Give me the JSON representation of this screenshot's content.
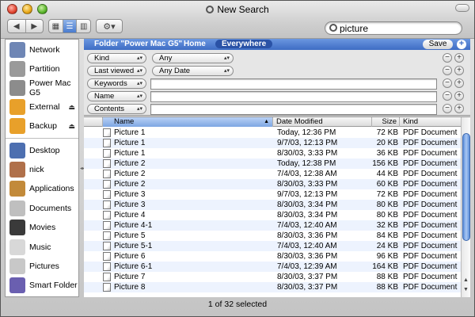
{
  "window": {
    "title": "New Search"
  },
  "toolbar": {
    "back_label": "◀",
    "forward_label": "▶",
    "view_icons": [
      "icon-view-icon",
      "list-view-icon",
      "column-view-icon"
    ],
    "action_label": "⚙▾",
    "search_value": "picture"
  },
  "sidebar": {
    "items": [
      {
        "label": "Network",
        "icon": "network-globe-icon",
        "color": "#6f86b5"
      },
      {
        "label": "Partition",
        "icon": "hard-disk-icon",
        "color": "#9a9a9a"
      },
      {
        "label": "Power Mac G5",
        "icon": "hard-disk-icon",
        "color": "#8c8c8c"
      },
      {
        "label": "External",
        "icon": "firewire-disk-icon",
        "color": "#e8a02a",
        "eject": "⏏"
      },
      {
        "label": "Backup",
        "icon": "firewire-disk-icon",
        "color": "#e8a02a",
        "eject": "⏏"
      },
      {
        "label": "Desktop",
        "icon": "desktop-icon",
        "color": "#4d6fb0"
      },
      {
        "label": "nick",
        "icon": "home-icon",
        "color": "#b0704a"
      },
      {
        "label": "Applications",
        "icon": "applications-icon",
        "color": "#c28a3a"
      },
      {
        "label": "Documents",
        "icon": "documents-icon",
        "color": "#bfbfbf"
      },
      {
        "label": "Movies",
        "icon": "movies-icon",
        "color": "#3a3a3a"
      },
      {
        "label": "Music",
        "icon": "music-icon",
        "color": "#d8d8d8"
      },
      {
        "label": "Pictures",
        "icon": "pictures-icon",
        "color": "#c8c8c8"
      },
      {
        "label": "Smart Folder",
        "icon": "smart-folder-icon",
        "color": "#6a5fb0"
      }
    ]
  },
  "scope": {
    "folder": "Folder \"Power Mac G5\"",
    "home": "Home",
    "everywhere": "Everywhere",
    "save": "Save",
    "add": "+"
  },
  "criteria": [
    {
      "attribute": "Kind",
      "value": "Any",
      "type": "popup"
    },
    {
      "attribute": "Last viewed",
      "value": "Any Date",
      "type": "popup"
    },
    {
      "attribute": "Keywords",
      "value": "",
      "type": "text"
    },
    {
      "attribute": "Name",
      "value": "",
      "type": "text"
    },
    {
      "attribute": "Contents",
      "value": "",
      "type": "text"
    }
  ],
  "list": {
    "columns": [
      "Name",
      "Date Modified",
      "Size",
      "Kind"
    ],
    "rows": [
      [
        "Picture 1",
        "Today, 12:36 PM",
        "72 KB",
        "PDF Document"
      ],
      [
        "Picture 1",
        "9/7/03, 12:13 PM",
        "20 KB",
        "PDF Document"
      ],
      [
        "Picture 1",
        "8/30/03, 3:33 PM",
        "36 KB",
        "PDF Document"
      ],
      [
        "Picture 2",
        "Today, 12:38 PM",
        "156 KB",
        "PDF Document"
      ],
      [
        "Picture 2",
        "7/4/03, 12:38 AM",
        "44 KB",
        "PDF Document"
      ],
      [
        "Picture 2",
        "8/30/03, 3:33 PM",
        "60 KB",
        "PDF Document"
      ],
      [
        "Picture 3",
        "9/7/03, 12:13 PM",
        "72 KB",
        "PDF Document"
      ],
      [
        "Picture 3",
        "8/30/03, 3:34 PM",
        "80 KB",
        "PDF Document"
      ],
      [
        "Picture 4",
        "8/30/03, 3:34 PM",
        "80 KB",
        "PDF Document"
      ],
      [
        "Picture 4-1",
        "7/4/03, 12:40 AM",
        "32 KB",
        "PDF Document"
      ],
      [
        "Picture 5",
        "8/30/03, 3:36 PM",
        "84 KB",
        "PDF Document"
      ],
      [
        "Picture 5-1",
        "7/4/03, 12:40 AM",
        "24 KB",
        "PDF Document"
      ],
      [
        "Picture 6",
        "8/30/03, 3:36 PM",
        "96 KB",
        "PDF Document"
      ],
      [
        "Picture 6-1",
        "7/4/03, 12:39 AM",
        "164 KB",
        "PDF Document"
      ],
      [
        "Picture 7",
        "8/30/03, 3:37 PM",
        "88 KB",
        "PDF Document"
      ],
      [
        "Picture 8",
        "8/30/03, 3:37 PM",
        "88 KB",
        "PDF Document"
      ]
    ]
  },
  "status": "1 of 32 selected"
}
